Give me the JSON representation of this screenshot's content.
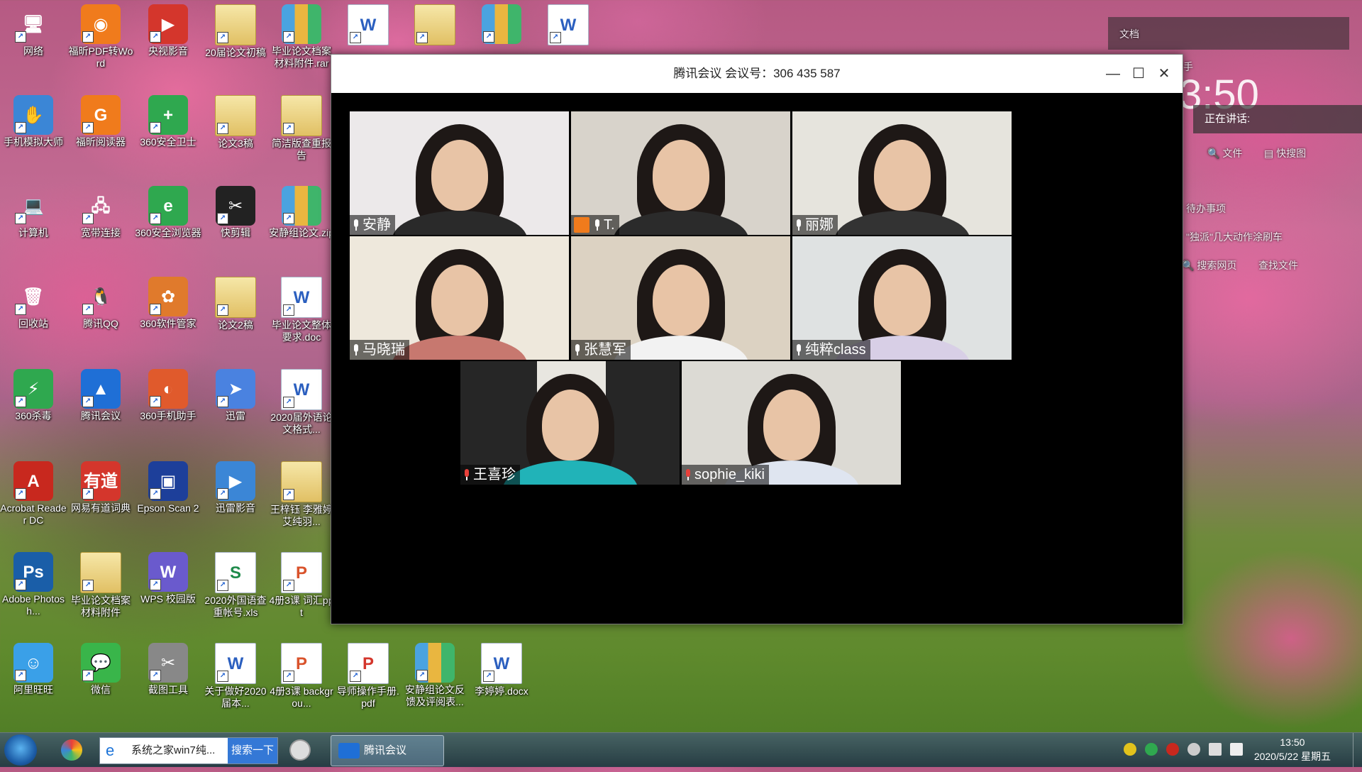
{
  "desktop": {
    "icons": [
      {
        "label": "网络",
        "glyph": "🖥",
        "col": 0,
        "row": 0
      },
      {
        "label": "福昕PDF转Word",
        "glyph": "◉",
        "col": 1,
        "row": 0,
        "color": "#f07b1c"
      },
      {
        "label": "央视影音",
        "glyph": "▶",
        "col": 2,
        "row": 0,
        "color": "#d4362c"
      },
      {
        "label": "20届论文初稿",
        "glyph": "",
        "col": 3,
        "row": 0,
        "type": "folder"
      },
      {
        "label": "毕业论文档案材料附件.rar",
        "glyph": "",
        "col": 4,
        "row": 0,
        "type": "zip"
      },
      {
        "label": "",
        "glyph": "W",
        "col": 5,
        "row": 0,
        "type": "word"
      },
      {
        "label": "",
        "glyph": "",
        "col": 6,
        "row": 0,
        "type": "folder"
      },
      {
        "label": "",
        "glyph": "",
        "col": 7,
        "row": 0,
        "type": "zip"
      },
      {
        "label": "",
        "glyph": "W",
        "col": 8,
        "row": 0,
        "type": "word"
      },
      {
        "label": "手机模拟大师",
        "glyph": "✋",
        "col": 0,
        "row": 1,
        "color": "#3b86d6"
      },
      {
        "label": "福昕阅读器",
        "glyph": "G",
        "col": 1,
        "row": 1,
        "color": "#f07b1c"
      },
      {
        "label": "360安全卫士",
        "glyph": "+",
        "col": 2,
        "row": 1,
        "color": "#2fa84f"
      },
      {
        "label": "论文3稿",
        "glyph": "",
        "col": 3,
        "row": 1,
        "type": "folder"
      },
      {
        "label": "简洁版查重报告",
        "glyph": "",
        "col": 4,
        "row": 1,
        "type": "folder"
      },
      {
        "label": "计算机",
        "glyph": "💻",
        "col": 0,
        "row": 2
      },
      {
        "label": "宽带连接",
        "glyph": "🖧",
        "col": 1,
        "row": 2
      },
      {
        "label": "360安全浏览器",
        "glyph": "e",
        "col": 2,
        "row": 2,
        "color": "#2fa84f"
      },
      {
        "label": "快剪辑",
        "glyph": "✂",
        "col": 3,
        "row": 2,
        "color": "#222"
      },
      {
        "label": "安静组论文.zip",
        "glyph": "",
        "col": 4,
        "row": 2,
        "type": "zip"
      },
      {
        "label": "回收站",
        "glyph": "🗑",
        "col": 0,
        "row": 3
      },
      {
        "label": "腾讯QQ",
        "glyph": "🐧",
        "col": 1,
        "row": 3
      },
      {
        "label": "360软件管家",
        "glyph": "✿",
        "col": 2,
        "row": 3,
        "color": "#e07a2c"
      },
      {
        "label": "论文2稿",
        "glyph": "",
        "col": 3,
        "row": 3,
        "type": "folder"
      },
      {
        "label": "毕业论文整体要求.doc",
        "glyph": "W",
        "col": 4,
        "row": 3,
        "type": "word"
      },
      {
        "label": "360杀毒",
        "glyph": "⚡",
        "col": 0,
        "row": 4,
        "color": "#2fa84f"
      },
      {
        "label": "腾讯会议",
        "glyph": "▲",
        "col": 1,
        "row": 4,
        "color": "#1f6fd6"
      },
      {
        "label": "360手机助手",
        "glyph": "◐",
        "col": 2,
        "row": 4,
        "color": "#e05a2c"
      },
      {
        "label": "迅雷",
        "glyph": "➤",
        "col": 3,
        "row": 4,
        "color": "#4a82e0"
      },
      {
        "label": "2020届外语论文格式...",
        "glyph": "W",
        "col": 4,
        "row": 4,
        "type": "word"
      },
      {
        "label": "Acrobat Reader DC",
        "glyph": "A",
        "col": 0,
        "row": 5,
        "color": "#c8281e"
      },
      {
        "label": "网易有道词典",
        "glyph": "有道",
        "col": 1,
        "row": 5,
        "color": "#d4362c"
      },
      {
        "label": "Epson Scan 2",
        "glyph": "▣",
        "col": 2,
        "row": 5,
        "color": "#1d3f9a"
      },
      {
        "label": "迅雷影音",
        "glyph": "▶",
        "col": 3,
        "row": 5,
        "color": "#3b86d6"
      },
      {
        "label": "王梓钰 李雅婷 艾纯羽...",
        "glyph": "",
        "col": 4,
        "row": 5,
        "type": "folder"
      },
      {
        "label": "Adobe Photosh...",
        "glyph": "Ps",
        "col": 0,
        "row": 6,
        "color": "#1a5ea8"
      },
      {
        "label": "毕业论文档案材料附件",
        "glyph": "",
        "col": 1,
        "row": 6,
        "type": "folder"
      },
      {
        "label": "WPS 校园版",
        "glyph": "W",
        "col": 2,
        "row": 6,
        "color": "#6a5acd"
      },
      {
        "label": "2020外国语查重帐号.xls",
        "glyph": "S",
        "col": 3,
        "row": 6,
        "type": "xls"
      },
      {
        "label": "4册3课 词汇ppt",
        "glyph": "P",
        "col": 4,
        "row": 6,
        "type": "ppt"
      },
      {
        "label": "阿里旺旺",
        "glyph": "☺",
        "col": 0,
        "row": 7,
        "color": "#3aa0e8"
      },
      {
        "label": "微信",
        "glyph": "💬",
        "col": 1,
        "row": 7,
        "color": "#39b54a"
      },
      {
        "label": "截图工具",
        "glyph": "✂",
        "col": 2,
        "row": 7,
        "color": "#888"
      },
      {
        "label": "关于做好2020届本...",
        "glyph": "W",
        "col": 3,
        "row": 7,
        "type": "word"
      },
      {
        "label": "4册3课 backgrou...",
        "glyph": "P",
        "col": 4,
        "row": 7,
        "type": "ppt"
      },
      {
        "label": "导师操作手册.pdf",
        "glyph": "P",
        "col": 5,
        "row": 7,
        "type": "pdf"
      },
      {
        "label": "安静组论文反馈及评阅表...",
        "glyph": "",
        "col": 6,
        "row": 7,
        "type": "zip"
      },
      {
        "label": "李婷婷.docx",
        "glyph": "W",
        "col": 7,
        "row": 7,
        "type": "word"
      }
    ]
  },
  "sidebar": {
    "doc_label": "文档",
    "assistant_label": "助手",
    "speaking_label": "正在讲话:",
    "search_file": "文件",
    "quick_search": "快搜图",
    "todo": "待办事项",
    "news": "\"独派\"几大动作涂刷车",
    "search_web": "搜索网页",
    "find_file": "查找文件"
  },
  "meeting": {
    "title": "腾讯会议  会议号：306 435 587",
    "participants": [
      {
        "name": "安静",
        "muted": false,
        "bg": "#ece9ea",
        "shirt": "#2a2a2a"
      },
      {
        "name": "T.",
        "muted": false,
        "bg": "#d8d3cb",
        "shirt": "#2b2b2b",
        "cam": true
      },
      {
        "name": "丽娜",
        "muted": false,
        "bg": "#e6e4dd",
        "shirt": "#333"
      },
      {
        "name": "马晓瑞",
        "muted": false,
        "bg": "#eee8dc",
        "shirt": "#c7786f"
      },
      {
        "name": "张慧军",
        "muted": false,
        "bg": "#dcd2c2",
        "shirt": "#f2f2f2"
      },
      {
        "name": "纯粹class",
        "muted": false,
        "bg": "#dfe2e2",
        "shirt": "#d8cfe6"
      },
      {
        "name": "王喜珍",
        "muted": true,
        "bg": "#e8e6e0",
        "shirt": "#21b3b8"
      },
      {
        "name": "sophie_kiki",
        "muted": true,
        "bg": "#dcdad4",
        "shirt": "#dfe5f0"
      }
    ]
  },
  "taskbar": {
    "search_text": "系统之家win7纯...",
    "search_button": "搜索一下",
    "active_app": "腾讯会议",
    "time": "13:50",
    "date": "2020/5/22 星期五"
  }
}
